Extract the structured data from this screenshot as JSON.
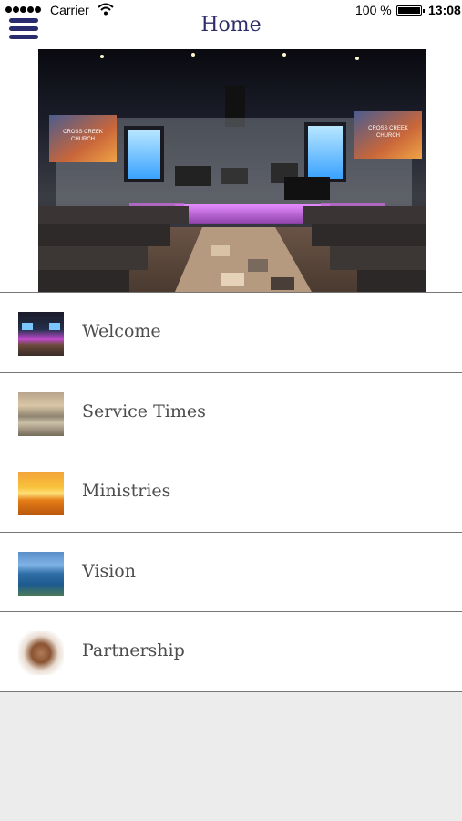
{
  "status_bar": {
    "carrier": "Carrier",
    "battery_percent": "100 %",
    "battery_level": 1.0,
    "time": "13:08",
    "icons": [
      "signal-dots-icon",
      "wifi-icon",
      "battery-icon"
    ]
  },
  "nav": {
    "title": "Home",
    "menu_icon": "hamburger-menu-icon",
    "accent_color": "#2a2a6e"
  },
  "hero": {
    "image_description_icon": "church-sanctuary-photo",
    "screen_text_left": "CROSS CREEK CHURCH",
    "screen_text_right": "CROSS CREEK CHURCH"
  },
  "menu": {
    "items": [
      {
        "label": "Welcome",
        "thumb": "church-stage-thumbnail"
      },
      {
        "label": "Service Times",
        "thumb": "landscape-thumbnail"
      },
      {
        "label": "Ministries",
        "thumb": "sunset-thumbnail"
      },
      {
        "label": "Vision",
        "thumb": "river-thumbnail"
      },
      {
        "label": "Partnership",
        "thumb": "hands-together-thumbnail"
      }
    ]
  }
}
